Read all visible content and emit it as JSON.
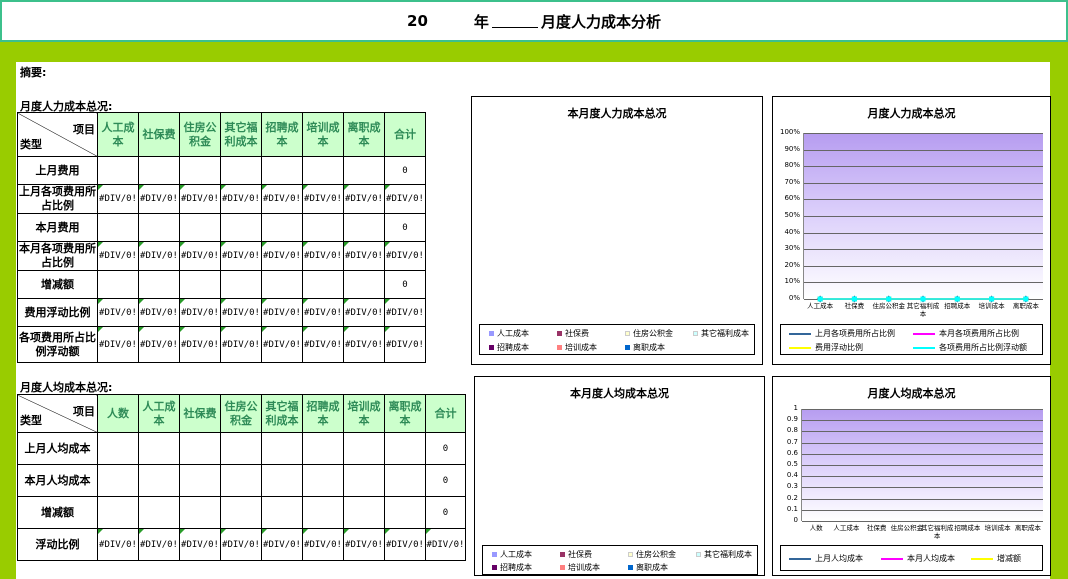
{
  "title": {
    "year_prefix": "20",
    "year_char": "年",
    "main": "月度人力成本分析"
  },
  "abstract_label": "摘要:",
  "section1": {
    "label": "月度人力成本总况:",
    "corner_left": "类型",
    "corner_right": "项目",
    "headers": [
      "人工成本",
      "社保费",
      "住房公积金",
      "其它福利成本",
      "招聘成本",
      "培训成本",
      "离职成本",
      "合计"
    ],
    "rows": [
      {
        "label": "上月费用",
        "cells": [
          "",
          "",
          "",
          "",
          "",
          "",
          "",
          "0"
        ]
      },
      {
        "label": "上月各项费用所占比例",
        "cells": [
          "#DIV/0!",
          "#DIV/0!",
          "#DIV/0!",
          "#DIV/0!",
          "#DIV/0!",
          "#DIV/0!",
          "#DIV/0!",
          "#DIV/0!"
        ]
      },
      {
        "label": "本月费用",
        "cells": [
          "",
          "",
          "",
          "",
          "",
          "",
          "",
          "0"
        ]
      },
      {
        "label": "本月各项费用所占比例",
        "cells": [
          "#DIV/0!",
          "#DIV/0!",
          "#DIV/0!",
          "#DIV/0!",
          "#DIV/0!",
          "#DIV/0!",
          "#DIV/0!",
          "#DIV/0!"
        ]
      },
      {
        "label": "增减额",
        "cells": [
          "",
          "",
          "",
          "",
          "",
          "",
          "",
          "0"
        ]
      },
      {
        "label": "费用浮动比例",
        "cells": [
          "#DIV/0!",
          "#DIV/0!",
          "#DIV/0!",
          "#DIV/0!",
          "#DIV/0!",
          "#DIV/0!",
          "#DIV/0!",
          "#DIV/0!"
        ]
      },
      {
        "label": "各项费用所占比例浮动额",
        "cells": [
          "#DIV/0!",
          "#DIV/0!",
          "#DIV/0!",
          "#DIV/0!",
          "#DIV/0!",
          "#DIV/0!",
          "#DIV/0!",
          "#DIV/0!"
        ]
      }
    ]
  },
  "section2": {
    "label": "月度人均成本总况:",
    "corner_left": "类型",
    "corner_right": "项目",
    "headers": [
      "人数",
      "人工成本",
      "社保费",
      "住房公积金",
      "其它福利成本",
      "招聘成本",
      "培训成本",
      "离职成本",
      "合计"
    ],
    "rows": [
      {
        "label": "上月人均成本",
        "cells": [
          "",
          "",
          "",
          "",
          "",
          "",
          "",
          "",
          "0"
        ]
      },
      {
        "label": "本月人均成本",
        "cells": [
          "",
          "",
          "",
          "",
          "",
          "",
          "",
          "",
          "0"
        ]
      },
      {
        "label": "增减额",
        "cells": [
          "",
          "",
          "",
          "",
          "",
          "",
          "",
          "",
          "0"
        ]
      },
      {
        "label": "浮动比例",
        "cells": [
          "#DIV/0!",
          "#DIV/0!",
          "#DIV/0!",
          "#DIV/0!",
          "#DIV/0!",
          "#DIV/0!",
          "#DIV/0!",
          "#DIV/0!",
          "#DIV/0!"
        ]
      }
    ]
  },
  "pie_legend": [
    {
      "label": "人工成本",
      "color": "#9999ff"
    },
    {
      "label": "社保费",
      "color": "#993366"
    },
    {
      "label": "住房公积金",
      "color": "#ffffcc"
    },
    {
      "label": "其它福利成本",
      "color": "#ccffff"
    },
    {
      "label": "招聘成本",
      "color": "#660066"
    },
    {
      "label": "培训成本",
      "color": "#ff8080"
    },
    {
      "label": "离职成本",
      "color": "#0066cc"
    }
  ],
  "chart_data": [
    {
      "type": "pie",
      "title": "本月度人力成本总况",
      "categories": [
        "人工成本",
        "社保费",
        "住房公积金",
        "其它福利成本",
        "招聘成本",
        "培训成本",
        "离职成本"
      ],
      "values": []
    },
    {
      "type": "line",
      "title": "月度人力成本总况",
      "categories": [
        "人工成本",
        "社保费",
        "住房公积金",
        "其它福利成本",
        "招聘成本",
        "培训成本",
        "离职成本"
      ],
      "yticks": [
        "100%",
        "90%",
        "80%",
        "70%",
        "60%",
        "50%",
        "40%",
        "30%",
        "20%",
        "10%",
        "0%"
      ],
      "ylim": [
        0,
        1
      ],
      "series": [
        {
          "name": "上月各项费用所占比例",
          "color": "#336699",
          "marker": "diamond",
          "values": [
            0,
            0,
            0,
            0,
            0,
            0,
            0
          ]
        },
        {
          "name": "本月各项费用所占比例",
          "color": "#ff00ff",
          "marker": "square",
          "values": [
            0,
            0,
            0,
            0,
            0,
            0,
            0
          ]
        },
        {
          "name": "费用浮动比例",
          "color": "#ffff00",
          "marker": "triangle",
          "values": [
            0,
            0,
            0,
            0,
            0,
            0,
            0
          ]
        },
        {
          "name": "各项费用所占比例浮动额",
          "color": "#00ffff",
          "marker": "x",
          "values": [
            0,
            0,
            0,
            0,
            0,
            0,
            0
          ]
        }
      ]
    },
    {
      "type": "pie",
      "title": "本月度人均成本总况",
      "categories": [
        "人工成本",
        "社保费",
        "住房公积金",
        "其它福利成本",
        "招聘成本",
        "培训成本",
        "离职成本"
      ],
      "values": []
    },
    {
      "type": "line",
      "title": "月度人均成本总况",
      "categories": [
        "人数",
        "人工成本",
        "社保费",
        "住房公积金",
        "其它福利成本",
        "招聘成本",
        "培训成本",
        "离职成本"
      ],
      "yticks": [
        "1",
        "0.9",
        "0.8",
        "0.7",
        "0.6",
        "0.5",
        "0.4",
        "0.3",
        "0.2",
        "0.1",
        "0"
      ],
      "ylim": [
        0,
        1
      ],
      "series": [
        {
          "name": "上月人均成本",
          "color": "#336699",
          "marker": "diamond",
          "values": []
        },
        {
          "name": "本月人均成本",
          "color": "#ff00ff",
          "marker": "square",
          "values": []
        },
        {
          "name": "增减额",
          "color": "#ffff00",
          "marker": "triangle",
          "values": []
        }
      ]
    }
  ]
}
